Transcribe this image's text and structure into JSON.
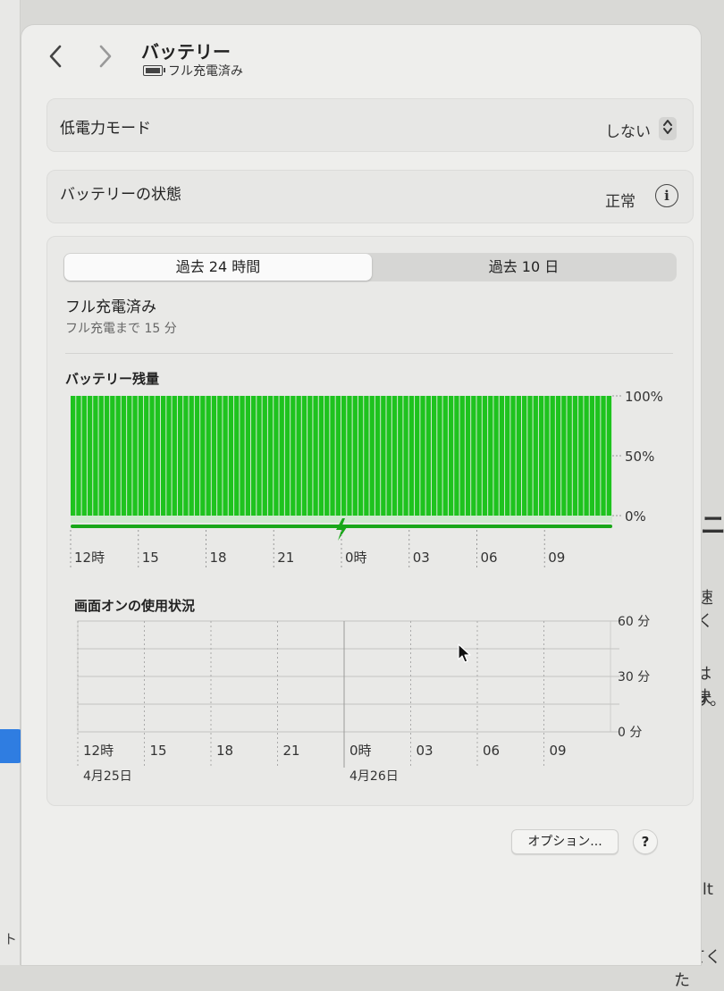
{
  "header": {
    "title": "バッテリー",
    "subtitle": "フル充電済み",
    "back_icon": "chevron-left-icon",
    "forward_icon": "chevron-right-icon"
  },
  "low_power": {
    "label": "低電力モード",
    "value": "しない"
  },
  "battery_health": {
    "label": "バッテリーの状態",
    "value": "正常"
  },
  "tabs": [
    {
      "label": "過去 24 時間",
      "selected": true
    },
    {
      "label": "過去 10 日",
      "selected": false
    }
  ],
  "status": {
    "main": "フル充電済み",
    "sub": "フル充電まで 15 分"
  },
  "colors": {
    "battery_green": "#1ec31e",
    "charging_green": "#18a818",
    "selection_blue": "#2f7de1"
  },
  "chart_data": [
    {
      "type": "bar",
      "title": "バッテリー残量",
      "x_ticks": [
        "12時",
        "15",
        "18",
        "21",
        "0時",
        "03",
        "06",
        "09"
      ],
      "y_ticks": [
        "100%",
        "50%",
        "0%"
      ],
      "ylim": [
        0,
        100
      ],
      "bars": 96,
      "values_percent": 100,
      "charging_all_period": true
    },
    {
      "type": "bar",
      "title": "画面オンの使用状況",
      "x_ticks": [
        "12時",
        "15",
        "18",
        "21",
        "0時",
        "03",
        "06",
        "09"
      ],
      "dates": [
        "4月25日",
        "4月26日"
      ],
      "y_ticks": [
        "60 分",
        "30 分",
        "0 分"
      ],
      "ylim": [
        0,
        60
      ],
      "values_minutes": []
    }
  ],
  "buttons": {
    "options": "オプション...",
    "help": "?"
  },
  "background_text": [
    "ニ",
    "速く",
    "は決",
    "す。",
    "rbolt",
    "してくた",
    "ト"
  ]
}
